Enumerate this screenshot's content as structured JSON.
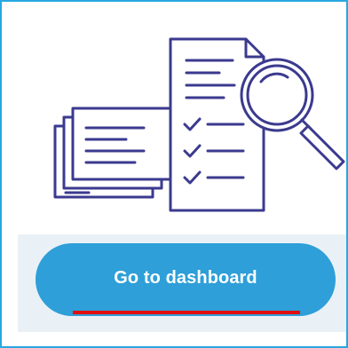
{
  "illustration": {
    "icon": "document-review-magnifier-icon",
    "stroke_color": "#3b3a8f"
  },
  "cta": {
    "label": "Go to dashboard",
    "background": "#2e9fd8",
    "text_color": "#ffffff"
  },
  "annotation": {
    "underline_color": "#e01010"
  },
  "frame": {
    "border_color": "#29a8e0"
  }
}
